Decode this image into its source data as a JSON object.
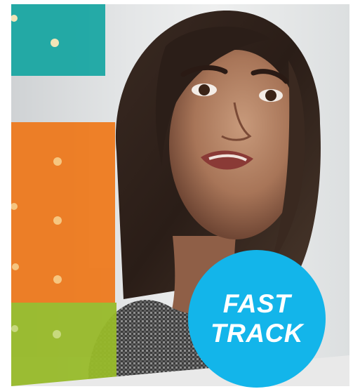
{
  "badge": {
    "line1": "FAST",
    "line2": "TRACK",
    "color": "#13b5ea"
  },
  "colors": {
    "teal_note": "#1aa7a3",
    "orange_note": "#ee7a1e",
    "green_note": "#98ba2a",
    "footer_band": "#e9e9e9"
  }
}
